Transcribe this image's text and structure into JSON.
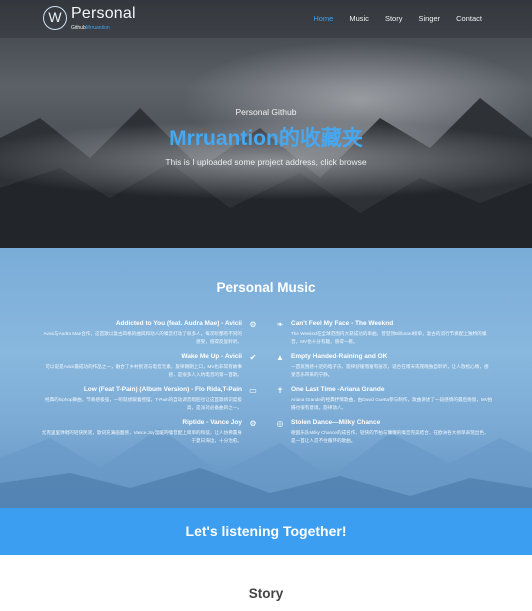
{
  "nav": {
    "logo_letter": "W",
    "logo_title": "Personal",
    "logo_sub_a": "Github",
    "logo_sub_b": "Mrruantion",
    "items": [
      "Home",
      "Music",
      "Story",
      "Singer",
      "Contact"
    ],
    "active_color": "#3ea1f0"
  },
  "hero": {
    "subtitle": "Personal Github",
    "title": "Mrruantion的收藏夹",
    "description": "This is I uploaded some project address, click browse"
  },
  "music": {
    "title": "Personal Music",
    "left": [
      {
        "title": "Addicted to You (feat. Audra Mae) - Avicii",
        "text": "Avicii与Audra Mae合作，这首歌以复古风格的曲风和动人的嗓音打动了很多人，每次听都有不同的感受，值得反复聆听。",
        "icon": "gear-icon"
      },
      {
        "title": "Wake Me Up - Avicii",
        "text": "可以说是Avicii最成功的作品之一，融合了乡村民谣与电音元素，旋律朗朗上口，MV也非常有故事感，是很多人入坑电音的第一首歌。",
        "icon": "check-icon"
      },
      {
        "title": "Low (Feat T-Pain) (Album Version) - Flo Rida,T-Pain",
        "text": "经典的hiphop舞曲，节奏感极强，一听就想跟着摇摆，T-Pain的自动调音唱腔也让这首歌辨识度极高，是派对必备曲目之一。",
        "icon": "monitor-icon"
      },
      {
        "title": "Riptide - Vance Joy",
        "text": "尤克里里弹唱的轻快民谣，歌词充满画面感，Vance Joy温暖的嗓音配上简单的和弦，让人仿佛置身于夏日海边，十分治愈。",
        "icon": "gear-icon"
      }
    ],
    "right": [
      {
        "title": "Can't Feel My Face - The Weeknd",
        "text": "The Weeknd在全球范围内大获成功的单曲，曾登顶Billboard榜单，复古的流行节奏配上独特的嗓音，MV也十分有趣，值得一看。",
        "icon": "leaf-icon"
      },
      {
        "title": "Empty Handed-Raining and OK",
        "text": "一首氛围感十足的电子乐，旋律舒缓而富有层次，适合在雨天或夜晚独自聆听，让人放松心情，感受音乐带来的宁静。",
        "icon": "chart-icon"
      },
      {
        "title": "One Last Time -Ariana Grande",
        "text": "Ariana Grande的经典抒情歌曲，由David Guetta参与制作，歌曲讲述了一段感情的最后挽留，MV拍摄也很有意境，旋律动人。",
        "icon": "pin-icon"
      },
      {
        "title": "Stolen Dance—Milky Chance",
        "text": "德国乐队Milky Chance的成名作，轻快的节拍与慵懒的嗓音完美结合，在欧洲各大榜单表现出色，是一首让人忍不住循环的歌曲。",
        "icon": "dribbble-icon"
      }
    ]
  },
  "banner": {
    "text": "Let's listening Together!"
  },
  "story": {
    "title": "Story"
  }
}
